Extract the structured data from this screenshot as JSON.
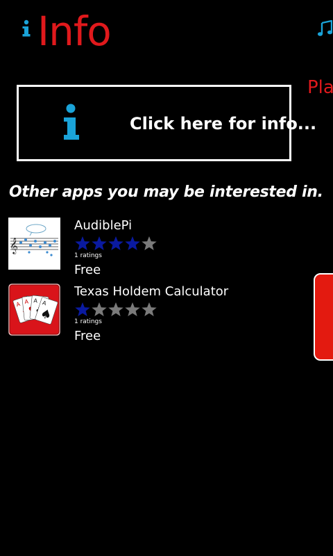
{
  "header": {
    "title": "Info",
    "page_icon": "info-icon",
    "music_icon": "music-note-icon",
    "title_color": "#e0191c",
    "accent_color": "#1aa3d8"
  },
  "next_pivot_peek": {
    "text": "Pla"
  },
  "info_banner": {
    "label": "Click here for info...",
    "icon": "info-icon"
  },
  "section": {
    "heading": "Other apps you may be interested in."
  },
  "apps": [
    {
      "name": "AudiblePi",
      "rating": 4,
      "max_rating": 5,
      "ratings_text": "1 ratings",
      "price": "Free",
      "icon": "music-score-thumbnail-icon"
    },
    {
      "name": "Texas Holdem Calculator",
      "rating": 1,
      "max_rating": 5,
      "ratings_text": "1 ratings",
      "price": "Free",
      "icon": "playing-cards-thumbnail-icon"
    }
  ],
  "colors": {
    "star_filled": "#0a1aa0",
    "star_empty": "#7a7a7a",
    "peek_panel": "#e31a10"
  }
}
